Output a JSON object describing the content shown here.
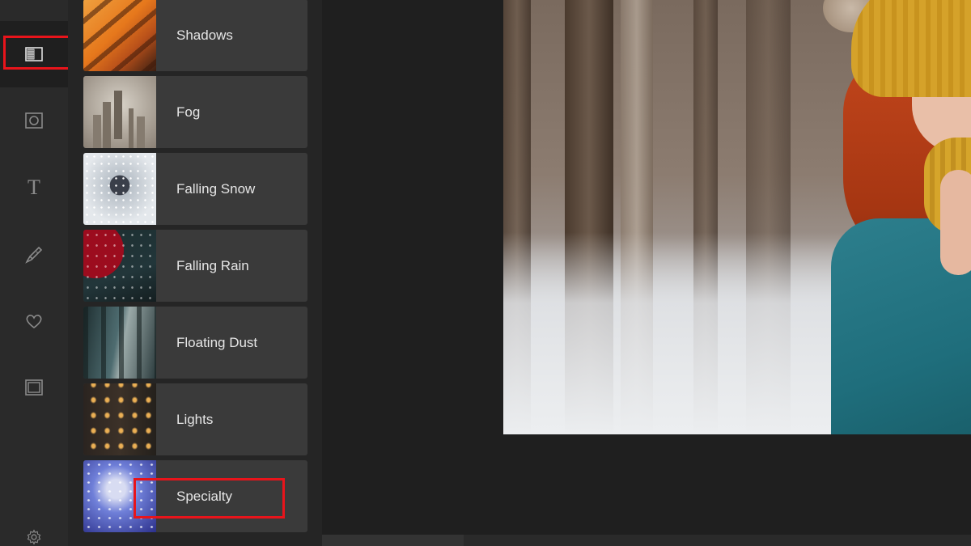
{
  "toolbar": {
    "items": [
      {
        "name": "effects-tool",
        "icon": "effects-icon",
        "active": true
      },
      {
        "name": "overlay-tool",
        "icon": "frame-circle-icon"
      },
      {
        "name": "text-tool",
        "icon": "text-icon",
        "glyph": "T"
      },
      {
        "name": "brush-tool",
        "icon": "brush-icon"
      },
      {
        "name": "favorites-tool",
        "icon": "heart-icon"
      },
      {
        "name": "frames-tool",
        "icon": "frame-icon"
      },
      {
        "name": "settings-tool",
        "icon": "gear-icon"
      }
    ]
  },
  "effects": {
    "items": [
      {
        "label": "Shadows"
      },
      {
        "label": "Fog"
      },
      {
        "label": "Falling Snow"
      },
      {
        "label": "Falling Rain"
      },
      {
        "label": "Floating Dust"
      },
      {
        "label": "Lights"
      },
      {
        "label": "Specialty"
      }
    ]
  },
  "colors": {
    "highlight": "#e8141b",
    "panel": "#252525",
    "card": "#3a3a3a",
    "rail": "#2a2a2a"
  }
}
